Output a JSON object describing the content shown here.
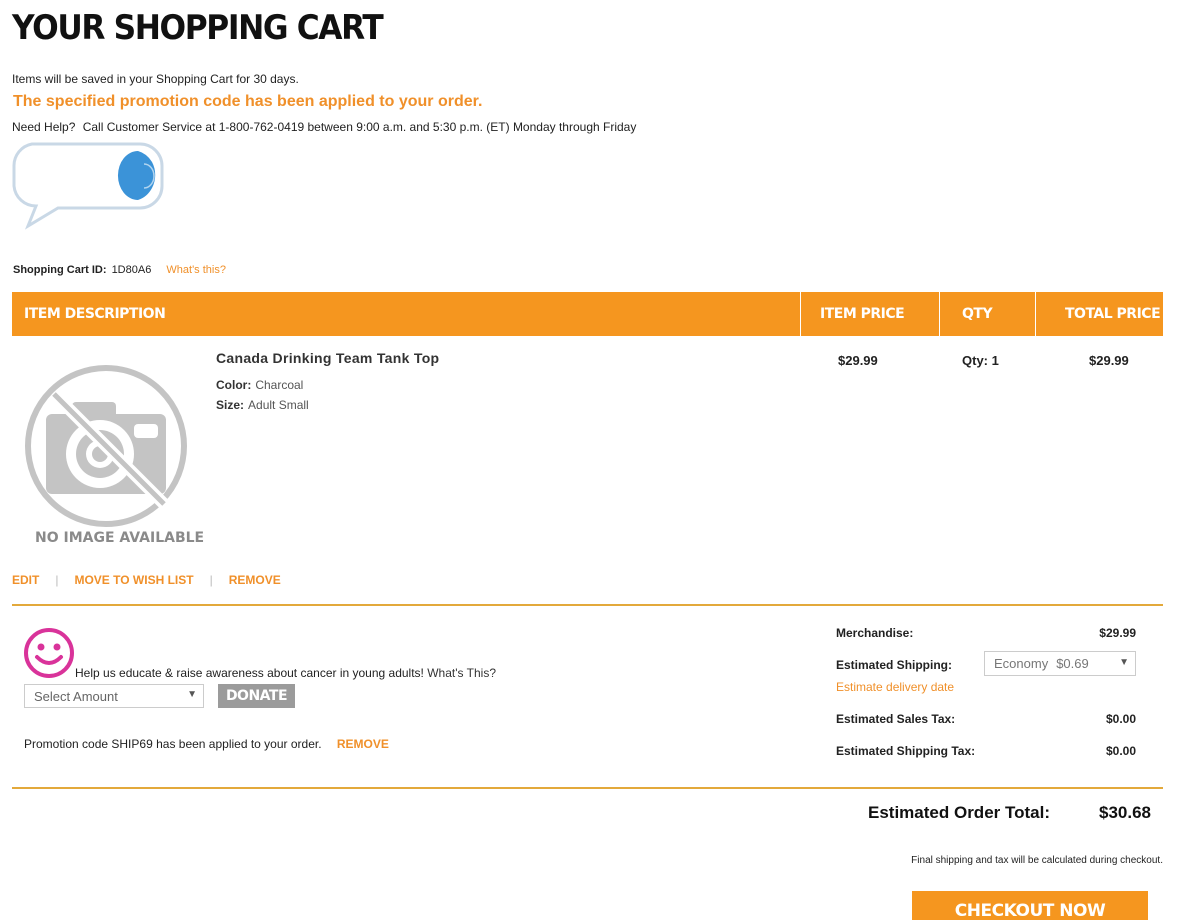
{
  "page": {
    "title": "YOUR SHOPPING CART",
    "save_note": "Items will be saved in your Shopping Cart for 30 days.",
    "promo_applied_message": "The specified promotion code has been applied to your order.",
    "help_label": "Need Help?",
    "help_text": "Call Customer Service at 1-800-762-0419 between 9:00 a.m. and 5:30 p.m. (ET) Monday through Friday"
  },
  "cart": {
    "id_label": "Shopping Cart ID:",
    "id_value": "1D80A6",
    "whats_this": "What's this?"
  },
  "table": {
    "headers": [
      "ITEM DESCRIPTION",
      "ITEM PRICE",
      "QTY",
      "TOTAL PRICE"
    ]
  },
  "item": {
    "no_image_label": "NO IMAGE AVAILABLE",
    "name": "Canada Drinking Team Tank Top",
    "color_label": "Color:",
    "color_value": "Charcoal",
    "size_label": "Size:",
    "size_value": "Adult Small",
    "price": "$29.99",
    "qty": "Qty: 1",
    "total": "$29.99",
    "actions": {
      "edit": "EDIT",
      "sep": "|",
      "wishlist": "MOVE TO WISH LIST",
      "remove": "REMOVE"
    }
  },
  "charity": {
    "text": "Help us educate & raise awareness about cancer in young adults!",
    "link": "What's This?",
    "select_placeholder": "Select Amount",
    "donate_label": "DONATE"
  },
  "promo": {
    "text_prefix": "Promotion code",
    "code": "SHIP69",
    "text_suffix": "has been applied to your order.",
    "remove_label": "REMOVE"
  },
  "summary": {
    "merchandise_label": "Merchandise:",
    "merchandise_value": "$29.99",
    "shipping_label": "Estimated Shipping:",
    "shipping_method": "Economy",
    "shipping_price": "$0.69",
    "delivery_link": "Estimate delivery date",
    "sales_tax_label": "Estimated Sales Tax:",
    "sales_tax_value": "$0.00",
    "shipping_tax_label": "Estimated Shipping Tax:",
    "shipping_tax_value": "$0.00",
    "order_total_label": "Estimated Order Total:",
    "order_total_value": "$30.68",
    "final_note": "Final shipping and tax will be calculated during checkout.",
    "checkout_label": "CHECKOUT NOW"
  },
  "colors": {
    "accent_orange": "#f5961f",
    "link_orange": "#f0902a",
    "smiley_pink": "#d9339a",
    "chat_blue": "#3b93d8"
  }
}
